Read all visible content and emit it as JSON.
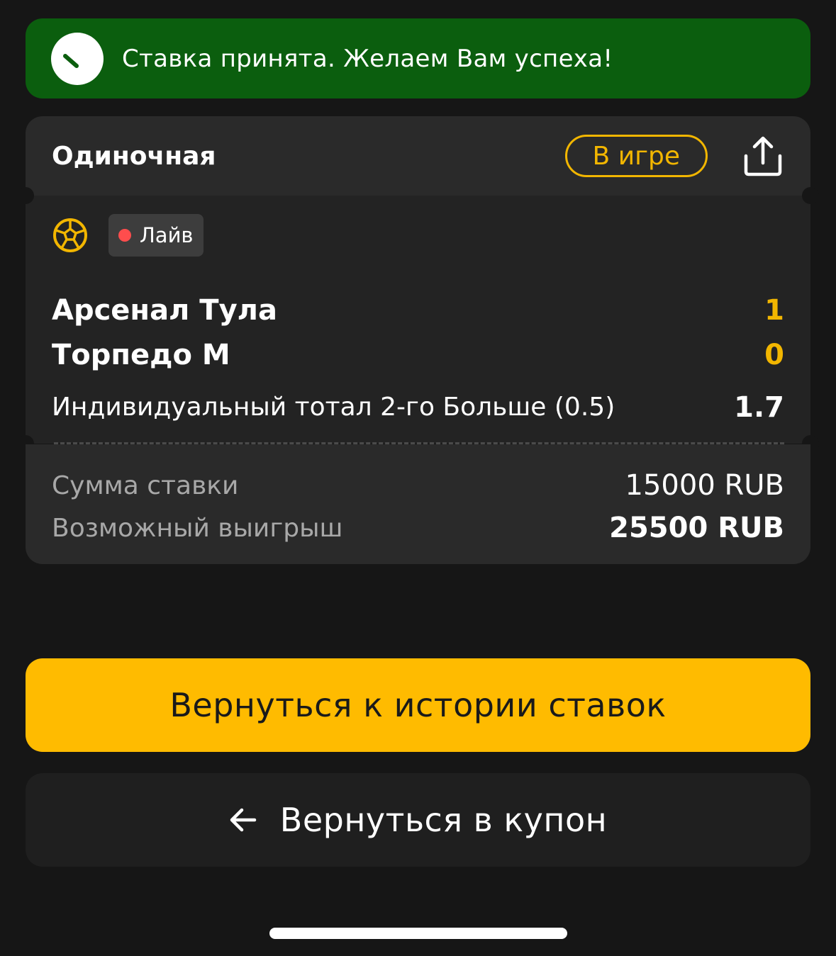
{
  "banner": {
    "message": "Ставка принята. Желаем Вам успеха!",
    "icon": "clock-icon",
    "color": "#0b5e0e"
  },
  "bet": {
    "type": "Одиночная",
    "status": "В игре",
    "share_icon": "share-icon",
    "sport_icon": "soccer-ball-icon",
    "live_label": "Лайв",
    "home_team": "Арсенал Тула",
    "home_score": "1",
    "away_team": "Торпедо М",
    "away_score": "0",
    "market": "Индивидуальный тотал 2-го Больше (0.5)",
    "odds": "1.7"
  },
  "summary": {
    "stake_label": "Сумма ставки",
    "stake_value": "15000 RUB",
    "payout_label": "Возможный выигрыш",
    "payout_value": "25500 RUB"
  },
  "actions": {
    "history_label": "Вернуться к истории ставок",
    "coupon_label": "Вернуться в купон",
    "back_icon": "arrow-left-icon"
  },
  "colors": {
    "accent": "#ffbb00",
    "status": "#f2b600",
    "live_dot": "#ff4d4d"
  }
}
